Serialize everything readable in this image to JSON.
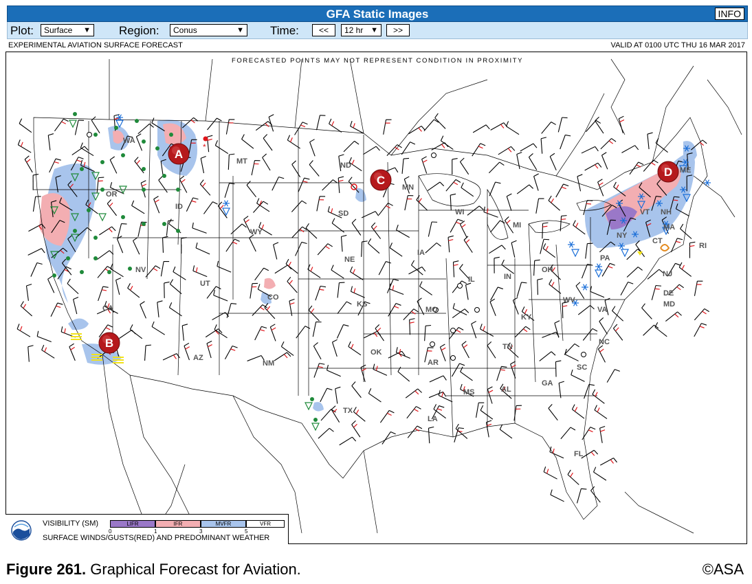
{
  "app": {
    "title": "GFA Static Images",
    "info_label": "INFO"
  },
  "controls": {
    "plot_label": "Plot:",
    "plot_value": "Surface",
    "region_label": "Region:",
    "region_value": "Conus",
    "time_label": "Time:",
    "time_prev": "<<",
    "time_value": "12 hr",
    "time_next": ">>"
  },
  "header": {
    "left": "EXPERIMENTAL AVIATION SURFACE FORECAST",
    "right": "VALID AT 0100 UTC THU 16 MAR 2017"
  },
  "map": {
    "notice": "FORECASTED POINTS MAY NOT REPRESENT CONDITION IN PROXIMITY",
    "state_labels": [
      "WA",
      "OR",
      "CA",
      "NV",
      "ID",
      "MT",
      "WY",
      "UT",
      "CO",
      "AZ",
      "NM",
      "ND",
      "SD",
      "NE",
      "KS",
      "OK",
      "TX",
      "MN",
      "IA",
      "MO",
      "AR",
      "LA",
      "WI",
      "IL",
      "MS",
      "AL",
      "GA",
      "FL",
      "MI",
      "IN",
      "OH",
      "KY",
      "TN",
      "SC",
      "NC",
      "VA",
      "WV",
      "PA",
      "NY",
      "VT",
      "NH",
      "ME",
      "MA",
      "CT",
      "RI",
      "NJ",
      "DE",
      "MD"
    ],
    "markers": [
      "A",
      "B",
      "C",
      "D"
    ],
    "colors": {
      "lifr": "#9a78c8",
      "ifr": "#f3aeb2",
      "mvfr": "#a8c4ec",
      "vfr": "#ffffff",
      "marker": "#b5191c",
      "gust": "#e0161b",
      "snow": "#1a6ed8",
      "rain": "#1f8a3a",
      "fog": "#f2e21a"
    },
    "weather_icons": [
      "snow-icon",
      "rain-icon",
      "fog-icon",
      "thunderstorm-icon"
    ]
  },
  "legend": {
    "visibility_label": "VISIBILITY (SM)",
    "categories": [
      "LIFR",
      "IFR",
      "MVFR",
      "VFR"
    ],
    "ticks": [
      "0",
      "1",
      "3",
      "5"
    ],
    "winds_label": "SURFACE WINDS/GUSTS(RED) AND PREDOMINANT WEATHER"
  },
  "caption": {
    "figure": "Figure 261.",
    "text": " Graphical Forecast for Aviation.",
    "copyright": "©ASA"
  }
}
